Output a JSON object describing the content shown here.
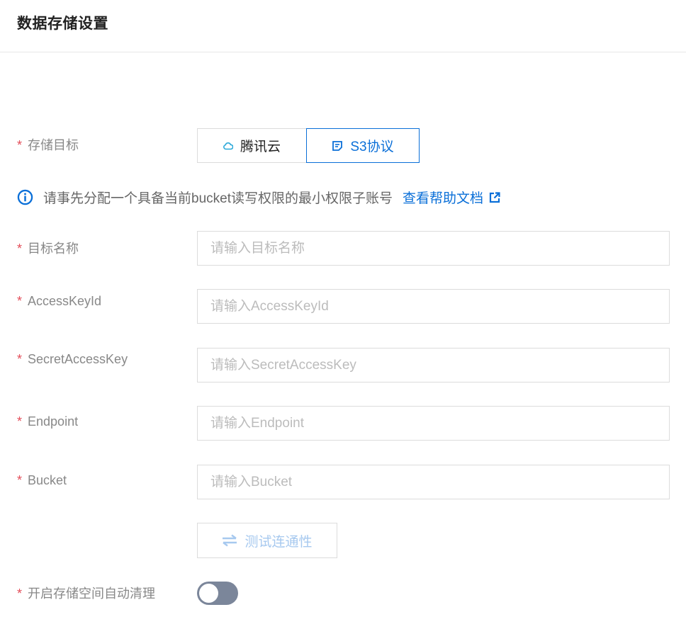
{
  "header": {
    "title": "数据存储设置"
  },
  "form": {
    "required_mark": "*",
    "storage_target": {
      "label": "存储目标",
      "options": [
        {
          "label": "腾讯云",
          "icon": "cloud-icon",
          "selected": false
        },
        {
          "label": "S3协议",
          "icon": "document-icon",
          "selected": true
        }
      ]
    },
    "notice": {
      "text": "请事先分配一个具备当前bucket读写权限的最小权限子账号",
      "link_label": "查看帮助文档",
      "icon": "info-icon"
    },
    "fields": [
      {
        "label": "目标名称",
        "placeholder": "请输入目标名称",
        "value": ""
      },
      {
        "label": "AccessKeyId",
        "placeholder": "请输入AccessKeyId",
        "value": ""
      },
      {
        "label": "SecretAccessKey",
        "placeholder": "请输入SecretAccessKey",
        "value": ""
      },
      {
        "label": "Endpoint",
        "placeholder": "请输入Endpoint",
        "value": ""
      },
      {
        "label": "Bucket",
        "placeholder": "请输入Bucket",
        "value": ""
      }
    ],
    "test_button": {
      "label": "测试连通性",
      "enabled": false
    },
    "auto_cleanup": {
      "label": "开启存储空间自动清理",
      "enabled": false
    }
  },
  "colors": {
    "primary": "#0a6fd8",
    "required": "#e34d59",
    "toggle_off": "#7b869a",
    "disabled_text": "#a7c9ef"
  }
}
